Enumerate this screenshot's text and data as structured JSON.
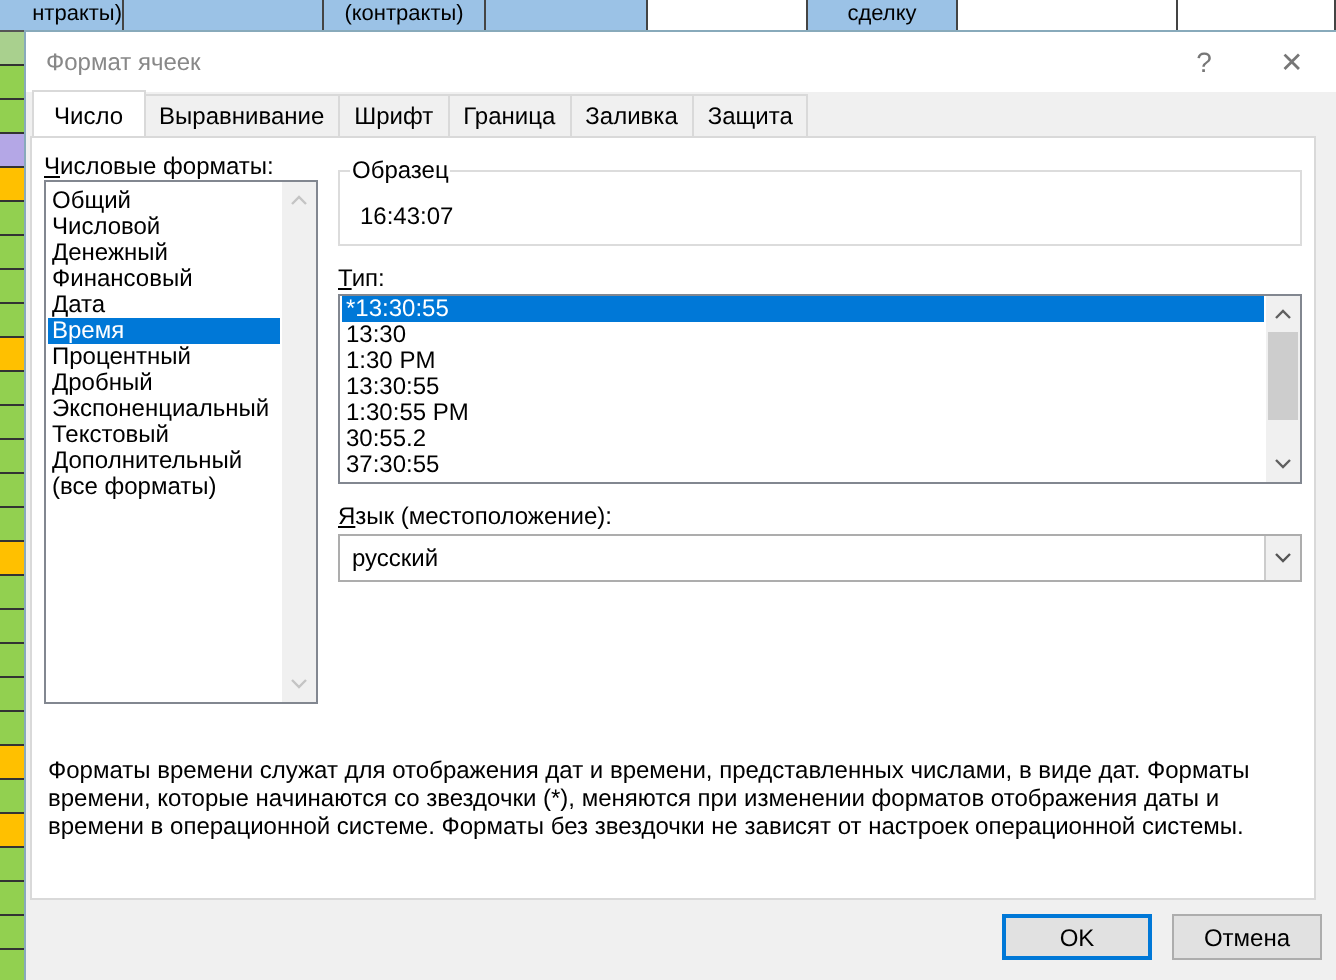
{
  "sheet": {
    "top_cells": [
      {
        "text": "нтракты)",
        "color": "#9bc2e6"
      },
      {
        "color": "#9bc2e6"
      },
      {
        "text": "(контракты)",
        "color": "#9bc2e6"
      },
      {
        "color": "#9bc2e6"
      },
      {
        "color": "#ffffff"
      },
      {
        "text": "сделку",
        "color": "#9bc2e6"
      },
      {
        "color": "#ffffff"
      },
      {
        "color": "#ffffff"
      }
    ],
    "side_cells": [
      {
        "color": "#a9d08e"
      },
      {
        "color": "#92d050"
      },
      {
        "color": "#92d050"
      },
      {
        "color": "#b4a7e6"
      },
      {
        "color": "#ffc000"
      },
      {
        "color": "#92d050"
      },
      {
        "color": "#92d050"
      },
      {
        "color": "#92d050"
      },
      {
        "color": "#92d050"
      },
      {
        "color": "#ffc000"
      },
      {
        "color": "#92d050"
      },
      {
        "color": "#92d050"
      },
      {
        "color": "#92d050"
      },
      {
        "color": "#92d050"
      },
      {
        "color": "#92d050"
      },
      {
        "color": "#ffc000"
      },
      {
        "color": "#92d050"
      },
      {
        "color": "#92d050"
      },
      {
        "color": "#92d050"
      },
      {
        "color": "#92d050"
      },
      {
        "color": "#92d050"
      },
      {
        "color": "#ffc000"
      },
      {
        "color": "#92d050"
      },
      {
        "color": "#ffc000"
      },
      {
        "color": "#92d050"
      },
      {
        "color": "#92d050"
      },
      {
        "color": "#92d050"
      },
      {
        "color": "#92d050"
      }
    ]
  },
  "window": {
    "title": "Формат ячеек",
    "help": "?",
    "close": "✕"
  },
  "tabs": [
    {
      "label": "Число",
      "selected": true
    },
    {
      "label": "Выравнивание",
      "selected": false
    },
    {
      "label": "Шрифт",
      "selected": false
    },
    {
      "label": "Граница",
      "selected": false
    },
    {
      "label": "Заливка",
      "selected": false
    },
    {
      "label": "Защита",
      "selected": false
    }
  ],
  "categories": {
    "label": "Числовые форматы:",
    "mnemonic": true,
    "items": [
      {
        "text": "Общий",
        "selected": false
      },
      {
        "text": "Числовой",
        "selected": false
      },
      {
        "text": "Денежный",
        "selected": false
      },
      {
        "text": "Финансовый",
        "selected": false
      },
      {
        "text": "Дата",
        "selected": false
      },
      {
        "text": "Время",
        "selected": true
      },
      {
        "text": "Процентный",
        "selected": false
      },
      {
        "text": "Дробный",
        "selected": false
      },
      {
        "text": "Экспоненциальный",
        "selected": false
      },
      {
        "text": "Текстовый",
        "selected": false
      },
      {
        "text": "Дополнительный",
        "selected": false
      },
      {
        "text": "(все форматы)",
        "selected": false
      }
    ]
  },
  "sample": {
    "label": "Образец",
    "value": "16:43:07"
  },
  "type": {
    "label": "Тип:",
    "mnemonic": true,
    "items": [
      {
        "text": "*13:30:55",
        "selected": true
      },
      {
        "text": "13:30",
        "selected": false
      },
      {
        "text": "1:30 PM",
        "selected": false
      },
      {
        "text": "13:30:55",
        "selected": false
      },
      {
        "text": "1:30:55 PM",
        "selected": false
      },
      {
        "text": "30:55.2",
        "selected": false
      },
      {
        "text": "37:30:55",
        "selected": false
      }
    ]
  },
  "locale": {
    "label": "Язык (местоположение):",
    "mnemonic": true,
    "value": "русский"
  },
  "description": "Форматы времени служат для отображения дат и времени, представленных числами, в виде дат. Форматы времени, которые начинаются со звездочки (*), меняются при изменении форматов отображения даты и времени в операционной системе. Форматы без звездочки не зависят от настроек операционной системы.",
  "buttons": [
    {
      "label": "OK",
      "default": true
    },
    {
      "label": "Отмена",
      "default": false
    }
  ]
}
